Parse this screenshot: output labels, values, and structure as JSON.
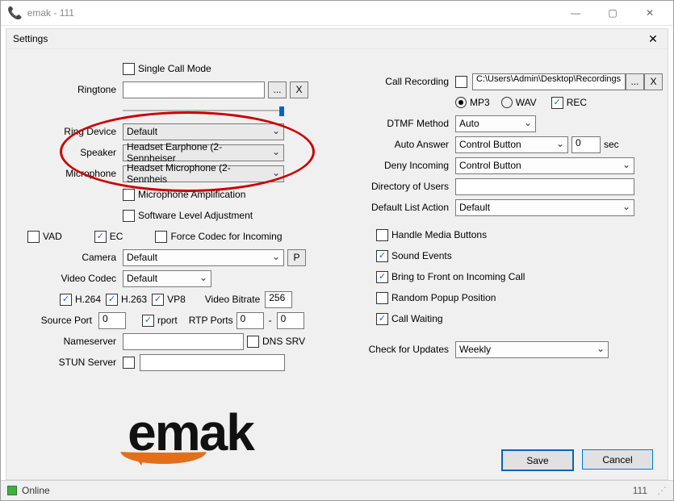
{
  "window": {
    "title": "emak - 111"
  },
  "settings_title": "Settings",
  "left": {
    "single_call_mode": "Single Call Mode",
    "ringtone_lbl": "Ringtone",
    "ringtone_val": "",
    "browse": "...",
    "clear": "X",
    "ring_device_lbl": "Ring Device",
    "ring_device_val": "Default",
    "speaker_lbl": "Speaker",
    "speaker_val": "Headset Earphone (2- Sennheiser",
    "mic_lbl": "Microphone",
    "mic_val": "Headset Microphone (2- Sennheis",
    "mic_amp": "Microphone Amplification",
    "sw_level": "Software Level Adjustment",
    "vad": "VAD",
    "ec": "EC",
    "force_codec": "Force Codec for Incoming",
    "camera_lbl": "Camera",
    "camera_val": "Default",
    "preview": "P",
    "vcodec_lbl": "Video Codec",
    "vcodec_val": "Default",
    "h264": "H.264",
    "h263": "H.263",
    "vp8": "VP8",
    "vbitrate_lbl": "Video Bitrate",
    "vbitrate_val": "256",
    "srcport_lbl": "Source Port",
    "srcport_val": "0",
    "rport": "rport",
    "rtp_lbl": "RTP Ports",
    "rtp_from": "0",
    "rtp_dash": "-",
    "rtp_to": "0",
    "ns_lbl": "Nameserver",
    "ns_val": "",
    "dnssrv": "DNS SRV",
    "stun_lbl": "STUN Server",
    "stun_val": ""
  },
  "right": {
    "callrec_lbl": "Call Recording",
    "callrec_path": "C:\\Users\\Admin\\Desktop\\Recordings",
    "browse": "...",
    "clear": "X",
    "mp3": "MP3",
    "wav": "WAV",
    "rec": "REC",
    "dtmf_lbl": "DTMF Method",
    "dtmf_val": "Auto",
    "aa_lbl": "Auto Answer",
    "aa_val": "Control Button",
    "aa_sec_val": "0",
    "aa_sec_lbl": "sec",
    "deny_lbl": "Deny Incoming",
    "deny_val": "Control Button",
    "dir_lbl": "Directory of Users",
    "dir_val": "",
    "deflist_lbl": "Default List Action",
    "deflist_val": "Default",
    "handle_media": "Handle Media Buttons",
    "sound_events": "Sound Events",
    "bring_front": "Bring to Front on Incoming Call",
    "random_popup": "Random Popup Position",
    "call_waiting": "Call Waiting",
    "updates_lbl": "Check for Updates",
    "updates_val": "Weekly"
  },
  "buttons": {
    "save": "Save",
    "cancel": "Cancel"
  },
  "status": {
    "online": "Online",
    "ext": "111"
  },
  "logo": {
    "text": "emak"
  }
}
